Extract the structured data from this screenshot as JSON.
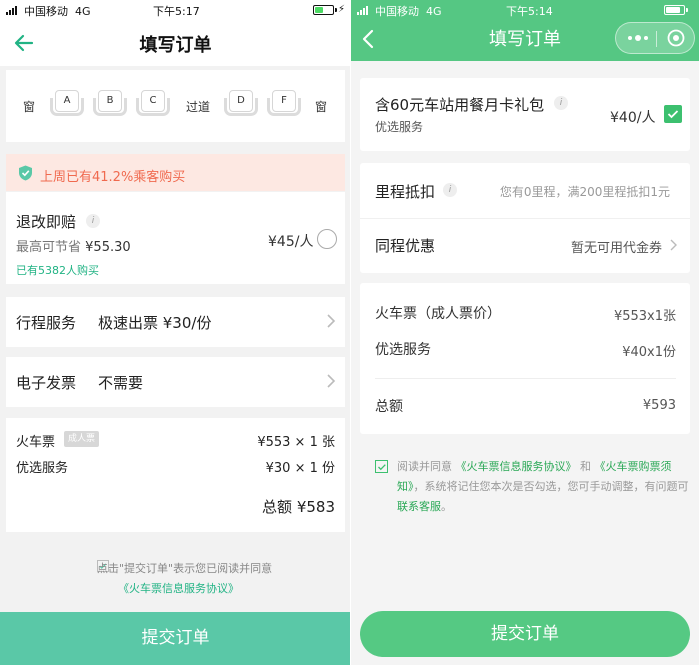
{
  "left": {
    "status": {
      "carrier": "中国移动",
      "network": "4G",
      "time": "下午5:17"
    },
    "title": "填写订单",
    "seat_map": {
      "window_left": "窗",
      "seats_left": [
        "A",
        "B",
        "C"
      ],
      "aisle": "过道",
      "seats_right": [
        "D",
        "F"
      ],
      "window_right": "窗"
    },
    "banner": "上周已有41.2%乘客购买",
    "refund": {
      "title": "退改即赔",
      "info": "i",
      "save_prefix": "最高可节省",
      "save_amount": "¥55.30",
      "buyers": "已有5382人购买",
      "price": "¥45/人"
    },
    "itinerary": {
      "label": "行程服务",
      "value": "极速出票 ¥30/份"
    },
    "invoice": {
      "label": "电子发票",
      "value": "不需要"
    },
    "summary": {
      "ticket_label": "火车票",
      "ticket_tag": "成人票",
      "ticket_price": "¥553 × 1 张",
      "service_label": "优选服务",
      "service_price": "¥30 × 1 份",
      "total": "总额  ¥583"
    },
    "agreement": {
      "text": "点击\"提交订单\"表示您已阅读并同意",
      "link": "《火车票信息服务协议》"
    },
    "submit": "提交订单"
  },
  "right": {
    "status": {
      "carrier": "中国移动",
      "network": "4G",
      "time": "下午5:14"
    },
    "title": "填写订单",
    "meal": {
      "title": "含60元车站用餐月卡礼包",
      "info": "i",
      "sub": "优选服务",
      "price": "¥40/人"
    },
    "mileage": {
      "label": "里程抵扣",
      "info": "i",
      "value": "您有0里程，满200里程抵扣1元"
    },
    "discount": {
      "label": "同程优惠",
      "value": "暂无可用代金券"
    },
    "summary": {
      "ticket_label": "火车票（成人票价）",
      "ticket_price": "¥553x1张",
      "service_label": "优选服务",
      "service_price": "¥40x1份",
      "total_label": "总额",
      "total_value": "¥593"
    },
    "agreement": {
      "pre": "阅读并同意",
      "link1": "《火车票信息服务协议》",
      "and": "和",
      "link2": "《火车票购票须知》",
      "mid": "，系统将记住您本次是否勾选，您可手动调整，有问题可",
      "link3": "联系客服",
      "end": "。"
    },
    "submit": "提交订单"
  },
  "colors": {
    "left_accent": "#5ac8a7",
    "right_accent": "#55c783",
    "warning": "#f06a4f",
    "link_green": "#21b384"
  },
  "icons": [
    "signal-icon",
    "battery-icon",
    "back-arrow-icon",
    "shield-check-icon",
    "info-icon",
    "radio-icon",
    "chevron-right-icon",
    "checkbox-checked-icon",
    "more-dots-icon",
    "close-target-icon"
  ]
}
